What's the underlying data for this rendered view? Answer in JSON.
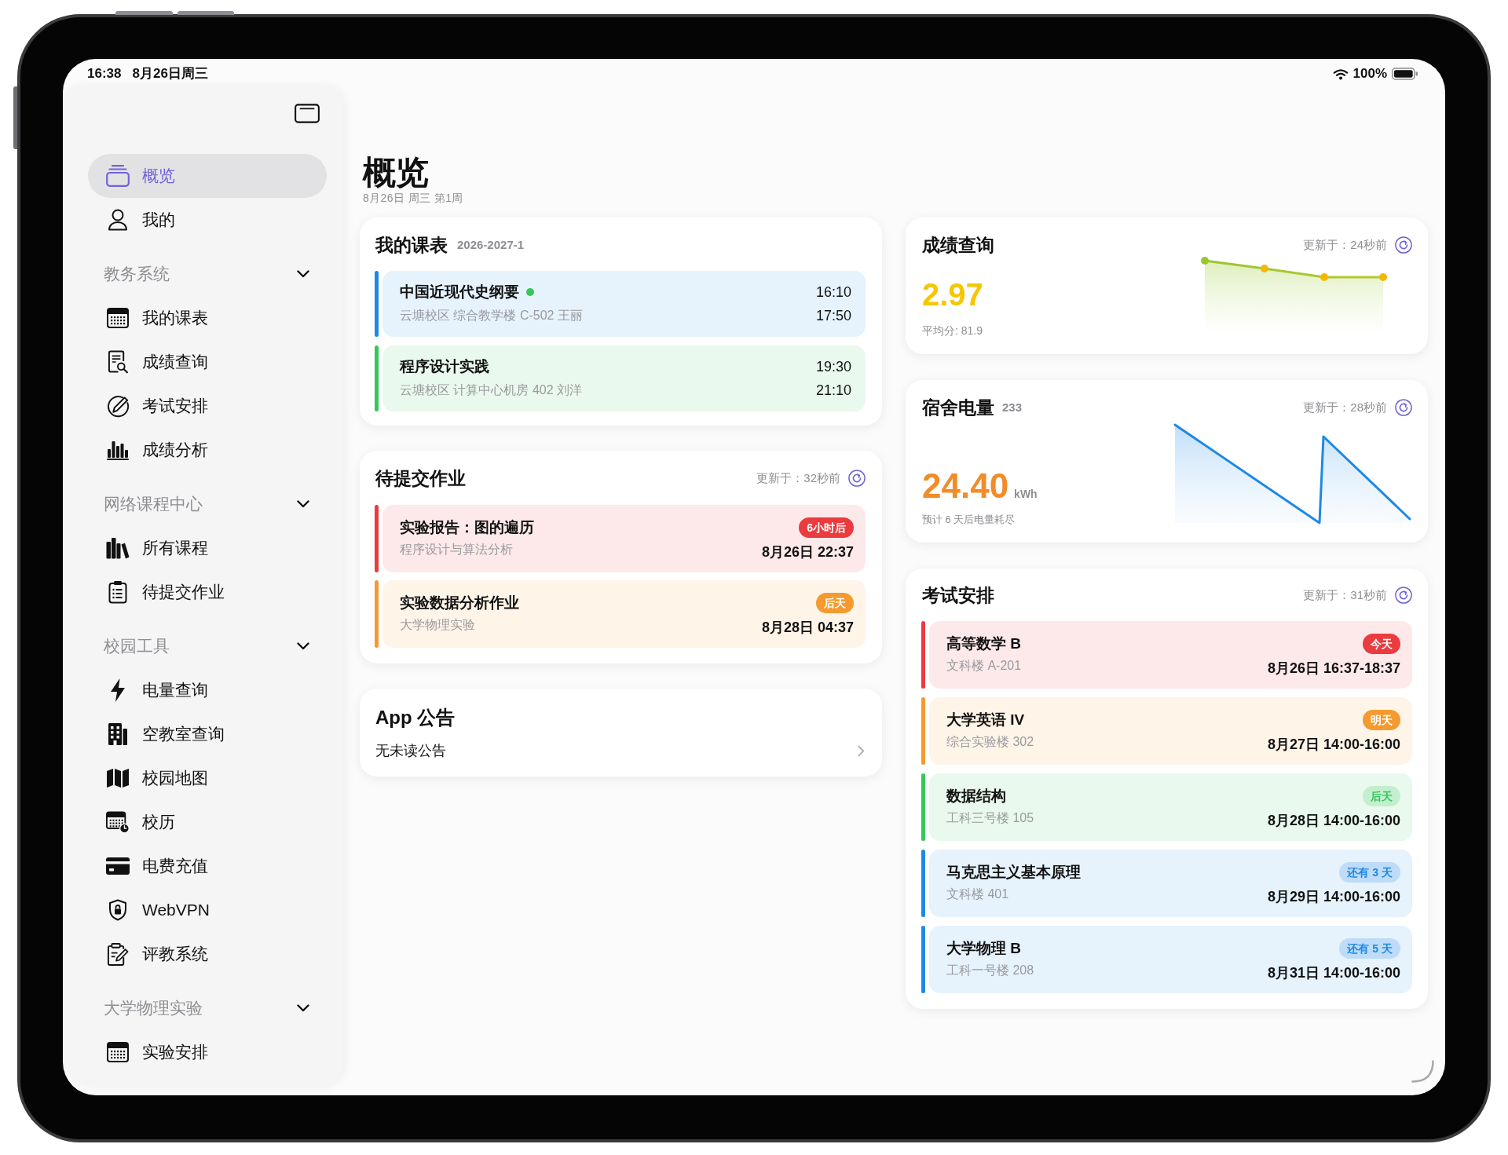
{
  "status_bar": {
    "time": "16:38",
    "date": "8月26日周三",
    "battery_text": "100%"
  },
  "sidebar": {
    "items": [
      {
        "label": "概览",
        "selected": true
      },
      {
        "label": "我的",
        "selected": false
      }
    ],
    "sections": [
      {
        "title": "教务系统",
        "expanded": true,
        "items": [
          {
            "label": "我的课表",
            "selected": false
          },
          {
            "label": "成绩查询",
            "selected": false
          },
          {
            "label": "考试安排",
            "selected": false
          },
          {
            "label": "成绩分析",
            "selected": false
          }
        ]
      },
      {
        "title": "网络课程中心",
        "expanded": true,
        "items": [
          {
            "label": "所有课程",
            "selected": false
          },
          {
            "label": "待提交作业",
            "selected": false
          }
        ]
      },
      {
        "title": "校园工具",
        "expanded": true,
        "items": [
          {
            "label": "电量查询",
            "selected": false
          },
          {
            "label": "空教室查询",
            "selected": false
          },
          {
            "label": "校园地图",
            "selected": false
          },
          {
            "label": "校历",
            "selected": false
          },
          {
            "label": "电费充值",
            "selected": false
          },
          {
            "label": "WebVPN",
            "selected": false
          },
          {
            "label": "评教系统",
            "selected": false
          }
        ]
      },
      {
        "title": "大学物理实验",
        "expanded": true,
        "items": [
          {
            "label": "实验安排",
            "selected": false
          }
        ]
      }
    ]
  },
  "page": {
    "title": "概览",
    "subtitle": "8月26日 周三 第1周"
  },
  "schedule": {
    "title": "我的课表",
    "term": "2026-2027-1",
    "rows": [
      {
        "course": "中国近现代史纲要",
        "live": true,
        "details": "云塘校区 综合教学楼 C-502 王丽",
        "start": "16:10",
        "end": "17:50",
        "color": "#1e88e5"
      },
      {
        "course": "程序设计实践",
        "live": false,
        "details": "云塘校区 计算中心机房 402 刘洋",
        "start": "19:30",
        "end": "21:10",
        "color": "#34c759"
      }
    ]
  },
  "homework": {
    "title": "待提交作业",
    "updated": "更新于：32秒前",
    "rows": [
      {
        "kind": "solid",
        "title": "实验报告：图的遍历",
        "course": "程序设计与算法分析",
        "badge": "6小时后",
        "due": "8月26日 22:37",
        "color": "#ea3b3f"
      },
      {
        "kind": "solid",
        "title": "实验数据分析作业",
        "course": "大学物理实验",
        "badge": "后天",
        "due": "8月28日 04:37",
        "color": "#f59a2e"
      }
    ]
  },
  "announcements": {
    "title": "App 公告",
    "message": "无未读公告"
  },
  "grades": {
    "title": "成绩查询",
    "updated": "更新于：24秒前",
    "gpa": "2.97",
    "average": "平均分: 81.9"
  },
  "electricity": {
    "title": "宿舍电量",
    "room": "233",
    "updated": "更新于：28秒前",
    "balance": "24.40",
    "unit": "kWh",
    "forecast": "预计 6 天后电量耗尽"
  },
  "exams": {
    "title": "考试安排",
    "updated": "更新于：31秒前",
    "rows": [
      {
        "kind": "solid",
        "course": "高等数学 B",
        "room": "文科楼 A-201",
        "badge": "今天",
        "time": "8月26日 16:37-18:37",
        "color": "#ea3b3f"
      },
      {
        "kind": "solid",
        "course": "大学英语 IV",
        "room": "综合实验楼 302",
        "badge": "明天",
        "time": "8月27日 14:00-16:00",
        "color": "#f59a2e"
      },
      {
        "kind": "soft",
        "course": "数据结构",
        "room": "工科三号楼 105",
        "badge": "后天",
        "time": "8月28日 14:00-16:00",
        "color": "#34c759"
      },
      {
        "kind": "soft",
        "course": "马克思主义基本原理",
        "room": "文科楼 401",
        "badge": "还有 3 天",
        "time": "8月29日 14:00-16:00",
        "color": "#1e88e5"
      },
      {
        "kind": "soft",
        "course": "大学物理 B",
        "room": "工科一号楼 208",
        "badge": "还有 5 天",
        "time": "8月31日 14:00-16:00",
        "color": "#1e88e5"
      }
    ]
  }
}
